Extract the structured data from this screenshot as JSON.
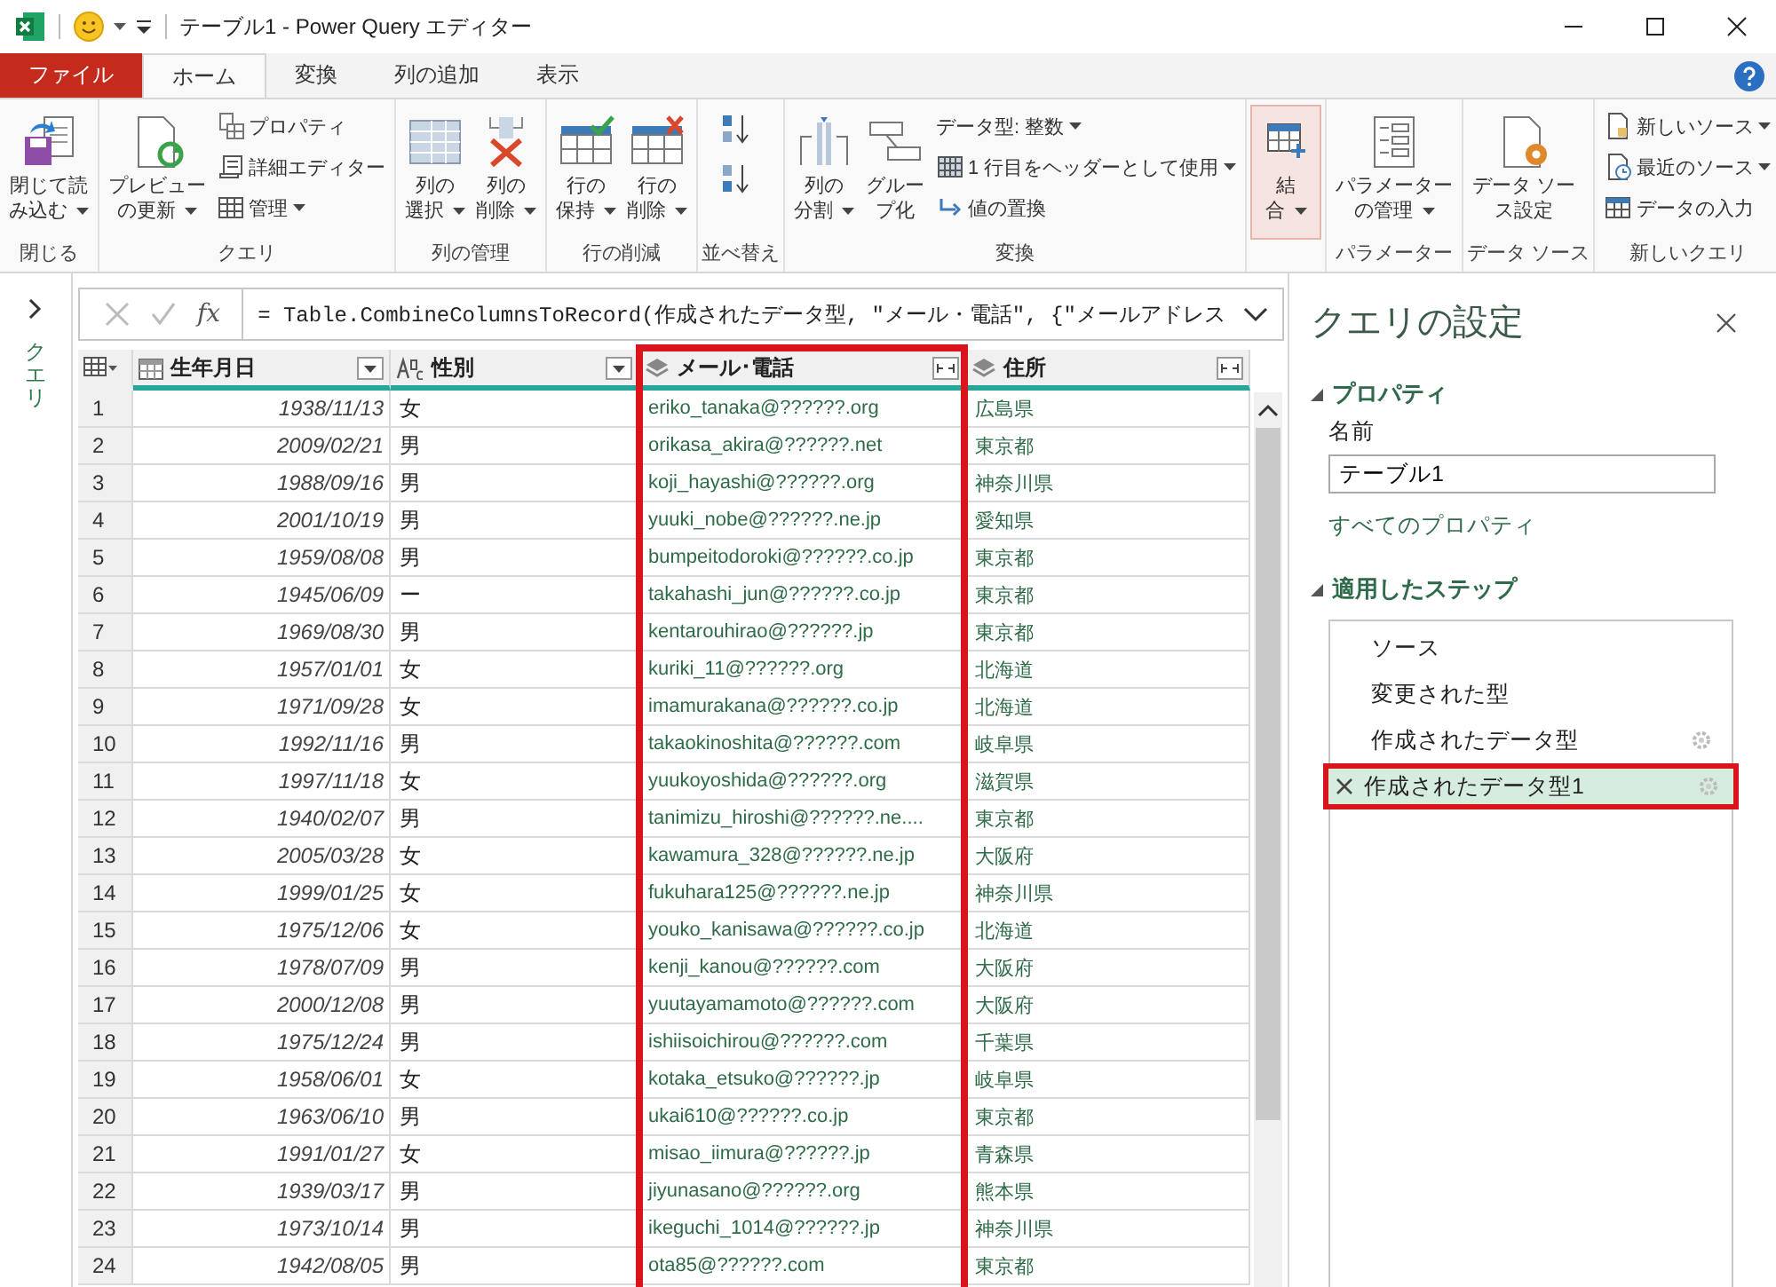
{
  "window": {
    "title": "テーブル1 - Power Query エディター"
  },
  "tabs": [
    {
      "label": "ファイル",
      "kind": "file",
      "selected": false
    },
    {
      "label": "ホーム",
      "kind": "tab",
      "selected": true
    },
    {
      "label": "変換",
      "kind": "tab",
      "selected": false
    },
    {
      "label": "列の追加",
      "kind": "tab",
      "selected": false
    },
    {
      "label": "表示",
      "kind": "tab",
      "selected": false
    }
  ],
  "ribbon": [
    {
      "label": "閉じる",
      "kind": "buttons",
      "items": [
        {
          "kind": "large",
          "lines": [
            "閉じて読",
            "み込む"
          ],
          "dropdown": true,
          "pressed": false
        }
      ]
    },
    {
      "label": "クエリ",
      "kind": "buttons",
      "items": [
        {
          "kind": "large",
          "lines": [
            "プレビュー",
            "の更新"
          ],
          "dropdown": true,
          "pressed": false
        },
        {
          "kind": "small",
          "label": "プロパティ",
          "dropdown": false
        },
        {
          "kind": "small",
          "label": "詳細エディター",
          "dropdown": false
        },
        {
          "kind": "small",
          "label": "管理",
          "dropdown": true
        }
      ]
    },
    {
      "label": "列の管理",
      "kind": "buttons",
      "items": [
        {
          "kind": "large",
          "lines": [
            "列の",
            "選択"
          ],
          "dropdown": true,
          "pressed": false
        },
        {
          "kind": "large",
          "lines": [
            "列の",
            "削除"
          ],
          "dropdown": true,
          "pressed": false
        }
      ]
    },
    {
      "label": "行の削減",
      "kind": "buttons",
      "items": [
        {
          "kind": "large",
          "lines": [
            "行の",
            "保持"
          ],
          "dropdown": true,
          "pressed": false
        },
        {
          "kind": "large",
          "lines": [
            "行の",
            "削除"
          ],
          "dropdown": true,
          "pressed": false
        }
      ]
    },
    {
      "label": "並べ替え",
      "kind": "sort"
    },
    {
      "label": "変換",
      "kind": "buttons",
      "items": [
        {
          "kind": "large",
          "lines": [
            "列の",
            "分割"
          ],
          "dropdown": true,
          "pressed": false
        },
        {
          "kind": "large",
          "lines": [
            "グルー",
            "プ化"
          ],
          "dropdown": false,
          "pressed": false
        },
        {
          "kind": "small",
          "label": "データ型: 整数",
          "dropdown": true
        },
        {
          "kind": "small",
          "label": "1 行目をヘッダーとして使用",
          "dropdown": true
        },
        {
          "kind": "small",
          "label": "値の置換",
          "dropdown": false
        }
      ]
    },
    {
      "kind": "buttons",
      "items": [
        {
          "kind": "large",
          "lines": [
            "結",
            "合"
          ],
          "dropdown": true,
          "pressed": true
        }
      ]
    },
    {
      "label": "パラメーター",
      "kind": "buttons",
      "items": [
        {
          "kind": "large",
          "lines": [
            "パラメーター",
            "の管理"
          ],
          "dropdown": true,
          "pressed": false
        }
      ]
    },
    {
      "label": "データ ソース",
      "kind": "buttons",
      "items": [
        {
          "kind": "large",
          "lines": [
            "データ ソー",
            "ス設定"
          ],
          "dropdown": false,
          "pressed": false
        }
      ]
    },
    {
      "label": "新しいクエリ",
      "kind": "buttons",
      "items": [
        {
          "kind": "small",
          "label": "新しいソース",
          "dropdown": true
        },
        {
          "kind": "small",
          "label": "最近のソース",
          "dropdown": true
        },
        {
          "kind": "small",
          "label": "データの入力",
          "dropdown": false
        }
      ]
    }
  ],
  "queries_pane": {
    "label": "クエリ"
  },
  "formula_bar": {
    "function_label": "fx",
    "formula": "= Table.CombineColumnsToRecord(作成されたデータ型, \"メール・電話\", {\"メールアドレス"
  },
  "table": {
    "columns": [
      {
        "name": "生年月日",
        "kind": "date",
        "highlighted": false
      },
      {
        "name": "性別",
        "kind": "text",
        "highlighted": false
      },
      {
        "name": "メール･電話",
        "kind": "record",
        "highlighted": true
      },
      {
        "name": "住所",
        "kind": "record",
        "highlighted": false
      }
    ],
    "rows": [
      {
        "number": "1",
        "cells": [
          "1938/11/13",
          "女",
          "eriko_tanaka@??????.org",
          "広島県"
        ]
      },
      {
        "number": "2",
        "cells": [
          "2009/02/21",
          "男",
          "orikasa_akira@??????.net",
          "東京都"
        ]
      },
      {
        "number": "3",
        "cells": [
          "1988/09/16",
          "男",
          "koji_hayashi@??????.org",
          "神奈川県"
        ]
      },
      {
        "number": "4",
        "cells": [
          "2001/10/19",
          "男",
          "yuuki_nobe@??????.ne.jp",
          "愛知県"
        ]
      },
      {
        "number": "5",
        "cells": [
          "1959/08/08",
          "男",
          "bumpeitodoroki@??????.co.jp",
          "東京都"
        ]
      },
      {
        "number": "6",
        "cells": [
          "1945/06/09",
          "ー",
          "takahashi_jun@??????.co.jp",
          "東京都"
        ]
      },
      {
        "number": "7",
        "cells": [
          "1969/08/30",
          "男",
          "kentarouhirao@??????.jp",
          "東京都"
        ]
      },
      {
        "number": "8",
        "cells": [
          "1957/01/01",
          "女",
          "kuriki_11@??????.org",
          "北海道"
        ]
      },
      {
        "number": "9",
        "cells": [
          "1971/09/28",
          "女",
          "imamurakana@??????.co.jp",
          "北海道"
        ]
      },
      {
        "number": "10",
        "cells": [
          "1992/11/16",
          "男",
          "takaokinoshita@??????.com",
          "岐阜県"
        ]
      },
      {
        "number": "11",
        "cells": [
          "1997/11/18",
          "女",
          "yuukoyoshida@??????.org",
          "滋賀県"
        ]
      },
      {
        "number": "12",
        "cells": [
          "1940/02/07",
          "男",
          "tanimizu_hiroshi@??????.ne....",
          "東京都"
        ]
      },
      {
        "number": "13",
        "cells": [
          "2005/03/28",
          "女",
          "kawamura_328@??????.ne.jp",
          "大阪府"
        ]
      },
      {
        "number": "14",
        "cells": [
          "1999/01/25",
          "女",
          "fukuhara125@??????.ne.jp",
          "神奈川県"
        ]
      },
      {
        "number": "15",
        "cells": [
          "1975/12/06",
          "女",
          "youko_kanisawa@??????.co.jp",
          "北海道"
        ]
      },
      {
        "number": "16",
        "cells": [
          "1978/07/09",
          "男",
          "kenji_kanou@??????.com",
          "大阪府"
        ]
      },
      {
        "number": "17",
        "cells": [
          "2000/12/08",
          "男",
          "yuutayamamoto@??????.com",
          "大阪府"
        ]
      },
      {
        "number": "18",
        "cells": [
          "1975/12/24",
          "男",
          "ishiisoichirou@??????.com",
          "千葉県"
        ]
      },
      {
        "number": "19",
        "cells": [
          "1958/06/01",
          "女",
          "kotaka_etsuko@??????.jp",
          "岐阜県"
        ]
      },
      {
        "number": "20",
        "cells": [
          "1963/06/10",
          "男",
          "ukai610@??????.co.jp",
          "東京都"
        ]
      },
      {
        "number": "21",
        "cells": [
          "1991/01/27",
          "女",
          "misao_iimura@??????.jp",
          "青森県"
        ]
      },
      {
        "number": "22",
        "cells": [
          "1939/03/17",
          "男",
          "jiyunasano@??????.org",
          "熊本県"
        ]
      },
      {
        "number": "23",
        "cells": [
          "1973/10/14",
          "男",
          "ikeguchi_1014@??????.jp",
          "神奈川県"
        ]
      },
      {
        "number": "24",
        "cells": [
          "1942/08/05",
          "男",
          "ota85@??????.com",
          "東京都"
        ]
      }
    ]
  },
  "settings": {
    "title": "クエリの設定",
    "properties_heading": "プロパティ",
    "name_label": "名前",
    "name_value": "テーブル1",
    "all_properties_link": "すべてのプロパティ",
    "steps_heading": "適用したステップ",
    "steps": [
      {
        "label": "ソース",
        "has_settings": false,
        "selected": false,
        "highlighted": false
      },
      {
        "label": "変更された型",
        "has_settings": false,
        "selected": false,
        "highlighted": false
      },
      {
        "label": "作成されたデータ型",
        "has_settings": true,
        "selected": false,
        "highlighted": false
      },
      {
        "label": "作成されたデータ型1",
        "has_settings": true,
        "selected": true,
        "highlighted": true
      }
    ]
  }
}
